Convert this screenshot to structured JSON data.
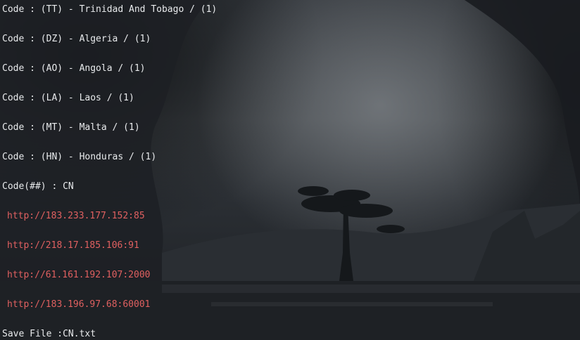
{
  "terminal": {
    "country_lines": [
      "Code : (TT) - Trinidad And Tobago / (1)",
      "Code : (DZ) - Algeria / (1)",
      "Code : (AO) - Angola / (1)",
      "Code : (LA) - Laos / (1)",
      "Code : (MT) - Malta / (1)",
      "Code : (HN) - Honduras / (1)"
    ],
    "code_prompt": "Code(##) : CN",
    "urls": [
      "http://183.233.177.152:85",
      "http://218.17.185.106:91",
      "http://61.161.192.107:2000",
      "http://183.196.97.68:60001"
    ],
    "save_line": "Save File :CN.txt"
  },
  "colors": {
    "text": "#e8eaec",
    "url": "#e06060"
  }
}
